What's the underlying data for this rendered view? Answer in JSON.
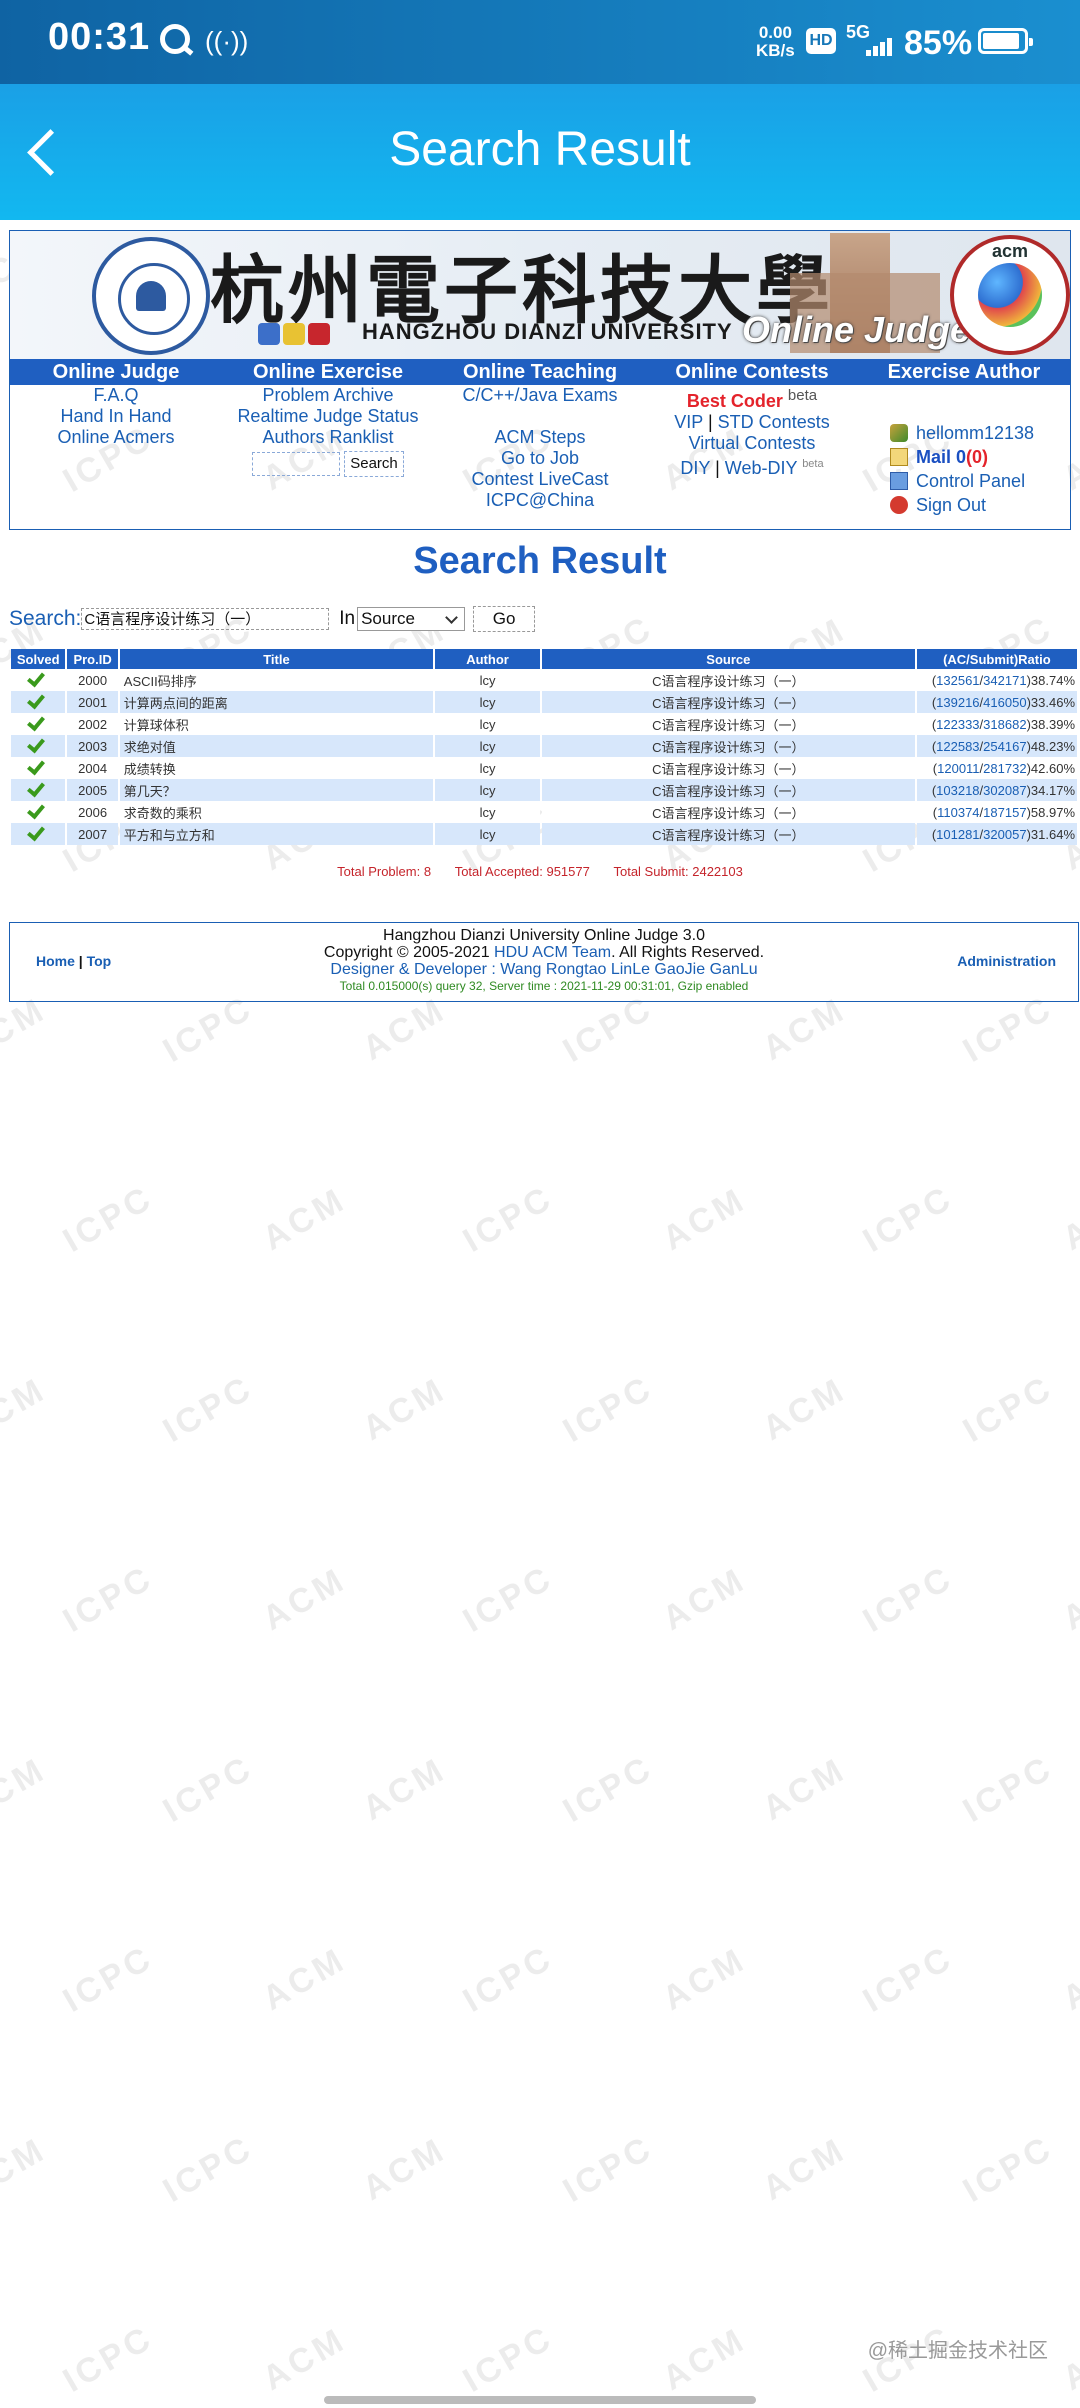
{
  "status_bar": {
    "time": "00:31",
    "speed_top": "0.00",
    "speed_bottom": "KB/s",
    "hd": "HD",
    "network": "5G",
    "battery": "85%"
  },
  "app_bar": {
    "title": "Search Result"
  },
  "banner": {
    "cn_title": "杭州電子科技大學",
    "en_title": "HANGZHOU DIANZI UNIVERSITY",
    "oj_title": "Online Judge",
    "acm_badge": "acm"
  },
  "nav": {
    "columns": [
      {
        "header": "Online Judge",
        "items": [
          "F.A.Q",
          "Hand In Hand",
          "Online Acmers"
        ]
      },
      {
        "header": "Online Exercise",
        "items": [
          "Problem Archive",
          "Realtime Judge Status",
          "Authors Ranklist"
        ],
        "search_button": "Search"
      },
      {
        "header": "Online Teaching",
        "items": [
          "C/C++/Java Exams",
          "ACM Steps",
          "Go to Job",
          "Contest LiveCast",
          "ICPC@China"
        ]
      },
      {
        "header": "Online Contests",
        "best_coder": "Best Coder",
        "best_coder_tag": "beta",
        "vip": "VIP",
        "separator": "|",
        "std": "STD Contests",
        "virtual": "Virtual Contests",
        "diy": "DIY",
        "webdiy": "Web-DIY",
        "webdiy_tag": "beta"
      },
      {
        "header": "Exercise Author",
        "username": "hellomm12138",
        "mail_label": "Mail 0",
        "mail_unread": "(0)",
        "control_panel": "Control Panel",
        "sign_out": "Sign Out"
      }
    ]
  },
  "heading": "Search Result",
  "search": {
    "label": "Search:",
    "value": "C语言程序设计练习（一）",
    "in_label": "In",
    "field": "Source",
    "go": "Go"
  },
  "table": {
    "headers": [
      "Solved",
      "Pro.ID",
      "Title",
      "Author",
      "Source",
      "(AC/Submit)Ratio"
    ],
    "rows": [
      {
        "id": "2000",
        "title": "ASCII码排序",
        "author": "lcy",
        "source": "C语言程序设计练习（一）",
        "ac": "132561",
        "submit": "342171",
        "ratio": "38.74%"
      },
      {
        "id": "2001",
        "title": "计算两点间的距离",
        "author": "lcy",
        "source": "C语言程序设计练习（一）",
        "ac": "139216",
        "submit": "416050",
        "ratio": "33.46%"
      },
      {
        "id": "2002",
        "title": "计算球体积",
        "author": "lcy",
        "source": "C语言程序设计练习（一）",
        "ac": "122333",
        "submit": "318682",
        "ratio": "38.39%"
      },
      {
        "id": "2003",
        "title": "求绝对值",
        "author": "lcy",
        "source": "C语言程序设计练习（一）",
        "ac": "122583",
        "submit": "254167",
        "ratio": "48.23%"
      },
      {
        "id": "2004",
        "title": "成绩转换",
        "author": "lcy",
        "source": "C语言程序设计练习（一）",
        "ac": "120011",
        "submit": "281732",
        "ratio": "42.60%"
      },
      {
        "id": "2005",
        "title": "第几天？",
        "author": "lcy",
        "source": "C语言程序设计练习（一）",
        "ac": "103218",
        "submit": "302087",
        "ratio": "34.17%"
      },
      {
        "id": "2006",
        "title": "求奇数的乘积",
        "author": "lcy",
        "source": "C语言程序设计练习（一）",
        "ac": "110374",
        "submit": "187157",
        "ratio": "58.97%"
      },
      {
        "id": "2007",
        "title": "平方和与立方和",
        "author": "lcy",
        "source": "C语言程序设计练习（一）",
        "ac": "101281",
        "submit": "320057",
        "ratio": "31.64%"
      }
    ]
  },
  "totals": {
    "problems": "Total Problem: 8",
    "accepted": "Total Accepted: 951577",
    "submit": "Total Submit: 2422103"
  },
  "footer": {
    "home": "Home",
    "separator": "|",
    "top": "Top",
    "admin": "Administration",
    "line1": "Hangzhou Dianzi University Online Judge 3.0",
    "copyright_prefix": "Copyright © 2005-2021 ",
    "team": "HDU ACM Team",
    "copyright_suffix": ". All Rights Reserved.",
    "designer": "Designer & Developer : Wang Rongtao LinLe GaoJie GanLu",
    "server": "Total 0.015000(s) query 32, Server time : 2021-11-29 00:31:01, Gzip enabled"
  },
  "watermark": {
    "a": "ACM",
    "b": "ICPC",
    "corner": "@稀土掘金技术社区"
  }
}
